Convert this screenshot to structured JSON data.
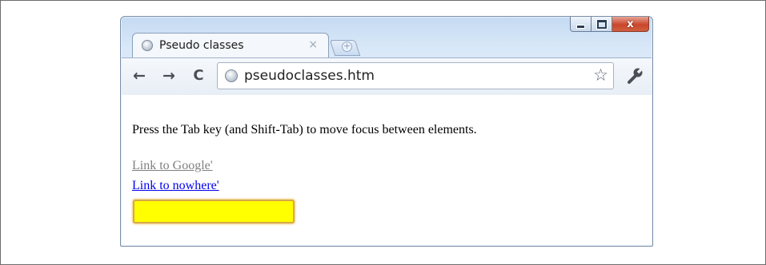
{
  "window": {
    "tab": {
      "title": "Pseudo classes",
      "close_glyph": "×",
      "favicon": "globe-icon"
    },
    "new_tab_glyph": "+",
    "caption": {
      "minimize": "minimize-icon",
      "maximize": "maximize-icon",
      "close_glyph": "x"
    }
  },
  "toolbar": {
    "back_glyph": "←",
    "forward_glyph": "→",
    "reload_glyph": "C",
    "address": "pseudoclasses.htm",
    "bookmark_glyph": "☆",
    "menu_icon": "wrench-icon"
  },
  "page": {
    "intro_text": "Press the Tab key (and Shift-Tab) to move focus between elements.",
    "link_google": "Link to Google'",
    "link_nowhere": "Link to nowhere'",
    "textbox_value": ""
  },
  "colors": {
    "focused_input_background": "#ffff00",
    "visited_link": "#808080",
    "unvisited_link": "#0000ee"
  }
}
